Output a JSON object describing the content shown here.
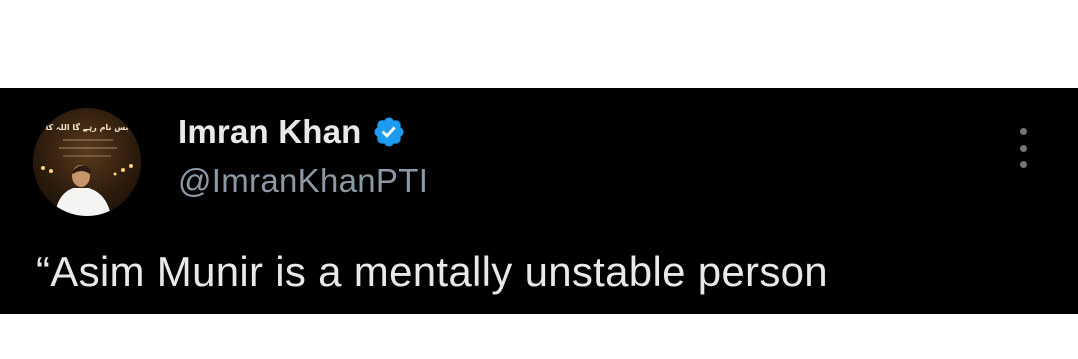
{
  "tweet": {
    "author": {
      "display_name": "Imran Khan",
      "handle": "@ImranKhanPTI",
      "verified_icon": "verified-badge-icon",
      "verified_color": "#1d9bf0",
      "avatar_banner_text": "بس نام رہے گا اللہ کا"
    },
    "text": "“Asim Munir is a mentally unstable person",
    "more_icon": "more-options-icon"
  },
  "colors": {
    "background": "#000000",
    "primary_text": "#e7e9ea",
    "secondary_text": "#8b98a5"
  }
}
